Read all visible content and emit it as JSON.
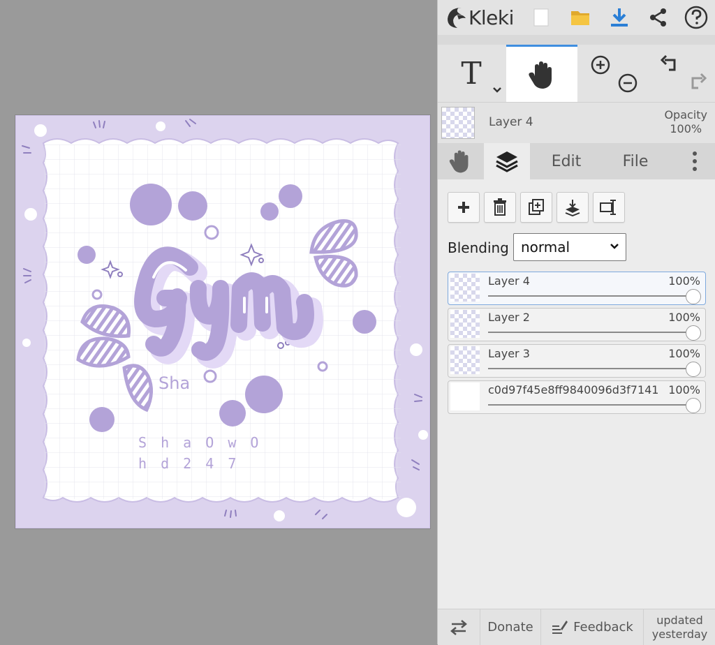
{
  "app": {
    "name": "Kleki"
  },
  "toolbar": {
    "new_icon": "new-file-icon",
    "open_icon": "folder-icon",
    "save_icon": "download-icon",
    "share_icon": "share-icon",
    "help_icon": "help-icon"
  },
  "tools": {
    "text_glyph": "T",
    "active": "hand"
  },
  "current_layer": {
    "name": "Layer 4",
    "opacity_label": "Opacity",
    "opacity_value": "100%"
  },
  "tabs": [
    {
      "id": "hand",
      "icon": "hand-icon"
    },
    {
      "id": "layers",
      "icon": "layers-icon",
      "active": true
    },
    {
      "id": "edit",
      "label": "Edit"
    },
    {
      "id": "file",
      "label": "File"
    },
    {
      "id": "more",
      "icon": "more-vertical-icon"
    }
  ],
  "blending": {
    "label": "Blending",
    "value": "normal"
  },
  "layers": [
    {
      "name": "Layer 4",
      "opacity": "100%",
      "opacity_fraction": 1.0,
      "active": true,
      "thumb": "checker"
    },
    {
      "name": "Layer 2",
      "opacity": "100%",
      "opacity_fraction": 1.0,
      "thumb": "checker"
    },
    {
      "name": "Layer 3",
      "opacity": "100%",
      "opacity_fraction": 1.0,
      "thumb": "checker"
    },
    {
      "name": "c0d97f45e8ff9840096d3f7141",
      "opacity": "100%",
      "opacity_fraction": 1.0,
      "thumb": "white"
    }
  ],
  "footer": {
    "donate": "Donate",
    "feedback": "Feedback",
    "updated_line1": "updated",
    "updated_line2": "yesterday"
  },
  "artwork": {
    "title": "Gym",
    "subtitle": "Sha",
    "credit_line1": "S h a O w O",
    "credit_line2": "h d 2 4 7",
    "colors": {
      "lavender": "#b3a3d8",
      "light_lavender": "#e7e0f4",
      "border_bg": "#dcd3ee"
    }
  },
  "colors": {
    "accent": "#3f8ee0",
    "panel": "#e3e3e3",
    "workspace": "#9a9a9a"
  }
}
